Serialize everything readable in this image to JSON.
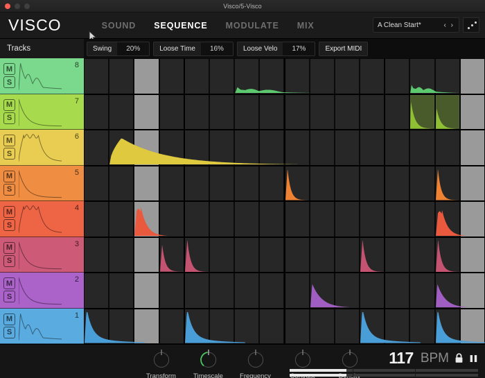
{
  "window": {
    "title": "Visco/5-Visco",
    "traffic_lights": [
      "close",
      "minimize",
      "zoom"
    ]
  },
  "nav": {
    "logo": "VISCO",
    "items": [
      {
        "label": "SOUND",
        "active": false
      },
      {
        "label": "SEQUENCE",
        "active": true
      },
      {
        "label": "MODULATE",
        "active": false
      },
      {
        "label": "MIX",
        "active": false
      }
    ],
    "preset": {
      "name": "A Clean Start*",
      "prev": "‹",
      "next": "›"
    }
  },
  "subbar": {
    "tracks_label": "Tracks",
    "controls": [
      {
        "label": "Swing",
        "value": "20%"
      },
      {
        "label": "Loose Time",
        "value": "16%"
      },
      {
        "label": "Loose Velo",
        "value": "17%"
      }
    ],
    "export_label": "Export MIDI"
  },
  "sequencer": {
    "columns": 16,
    "highlighted_columns": [
      2,
      15
    ],
    "beat_divider_columns": [
      4,
      8,
      12
    ],
    "mute_label": "M",
    "solo_label": "S",
    "tracks": [
      {
        "number": "8",
        "color": "#7ad98c",
        "note_color": "#5cc96f",
        "envelope": "multi-peak-decay"
      },
      {
        "number": "7",
        "color": "#a8da4e",
        "note_color": "#8fbf33",
        "envelope": "sharp-decay"
      },
      {
        "number": "6",
        "color": "#e8cd52",
        "note_color": "#dfc93f",
        "envelope": "plateau"
      },
      {
        "number": "5",
        "color": "#ef8e43",
        "note_color": "#ef8232",
        "envelope": "sharp-decay"
      },
      {
        "number": "4",
        "color": "#ee6546",
        "note_color": "#e9593d",
        "envelope": "plateau"
      },
      {
        "number": "3",
        "color": "#cd5b77",
        "note_color": "#c35370",
        "envelope": "sharp-decay"
      },
      {
        "number": "2",
        "color": "#ab62c9",
        "note_color": "#a05ec2",
        "envelope": "sharp-decay"
      },
      {
        "number": "1",
        "color": "#5aabdf",
        "note_color": "#4a9ed8",
        "envelope": "multi-peak-decay"
      }
    ],
    "notes": [
      {
        "track": "8",
        "column": 6,
        "span": 4,
        "shape": "long-bumpy",
        "height": 0.22
      },
      {
        "track": "8",
        "column": 13,
        "span": 2.2,
        "shape": "long-bumpy",
        "height": 0.3
      },
      {
        "track": "7",
        "column": 13,
        "span": 1,
        "shape": "decay",
        "height": 0.8,
        "selected": true
      },
      {
        "track": "7",
        "column": 14,
        "span": 1,
        "shape": "decay",
        "height": 0.6,
        "selected": true
      },
      {
        "track": "6",
        "column": 1,
        "span": 8,
        "shape": "slow-decay",
        "height": 0.78
      },
      {
        "track": "5",
        "column": 8,
        "span": 1.2,
        "shape": "spike",
        "height": 0.92
      },
      {
        "track": "5",
        "column": 14,
        "span": 1.2,
        "shape": "spike",
        "height": 0.92
      },
      {
        "track": "4",
        "column": 2,
        "span": 2.1,
        "shape": "bumpy-spike",
        "height": 0.88
      },
      {
        "track": "4",
        "column": 14,
        "span": 2.1,
        "shape": "bumpy-spike",
        "height": 0.8
      },
      {
        "track": "3",
        "column": 3,
        "span": 1.2,
        "shape": "spike",
        "height": 0.8
      },
      {
        "track": "3",
        "column": 4,
        "span": 1.3,
        "shape": "spike",
        "height": 0.95
      },
      {
        "track": "3",
        "column": 11,
        "span": 1.3,
        "shape": "spike",
        "height": 0.95
      },
      {
        "track": "3",
        "column": 14,
        "span": 1.3,
        "shape": "spike",
        "height": 0.95
      },
      {
        "track": "2",
        "column": 9,
        "span": 2.4,
        "shape": "decay",
        "height": 0.7
      },
      {
        "track": "2",
        "column": 14,
        "span": 2.0,
        "shape": "decay",
        "height": 0.7
      },
      {
        "track": "1",
        "column": 0,
        "span": 2.4,
        "shape": "multi-decay",
        "height": 0.9
      },
      {
        "track": "1",
        "column": 4,
        "span": 2.4,
        "shape": "multi-decay",
        "height": 0.9
      },
      {
        "track": "1",
        "column": 11,
        "span": 2.4,
        "shape": "multi-decay",
        "height": 0.9
      },
      {
        "track": "1",
        "column": 14,
        "span": 2.4,
        "shape": "multi-decay",
        "height": 0.9
      }
    ]
  },
  "transport": {
    "knobs": [
      {
        "label": "Transform",
        "value": 0.5,
        "arc": false
      },
      {
        "label": "Timescale",
        "value": 0.5,
        "arc": true,
        "arc_color": "#49c362"
      },
      {
        "label": "Frequency",
        "value": 0.5,
        "arc": false
      },
      {
        "label": "Contrast",
        "value": 0.5,
        "arc": false
      },
      {
        "label": "Density",
        "value": 0.5,
        "arc": false
      }
    ],
    "bpm_value": "117",
    "bpm_unit": "BPM",
    "lock_icon": "lock-icon",
    "play_icon": "pause-icon",
    "progress_bars": [
      {
        "fill": 0.3
      },
      {
        "fill": 0.3
      }
    ]
  },
  "colors": {
    "accent_green": "#49c362",
    "panel_bg": "#1b1b1b",
    "grid_cell": "#272727",
    "grid_highlight": "#9a9a9a"
  }
}
